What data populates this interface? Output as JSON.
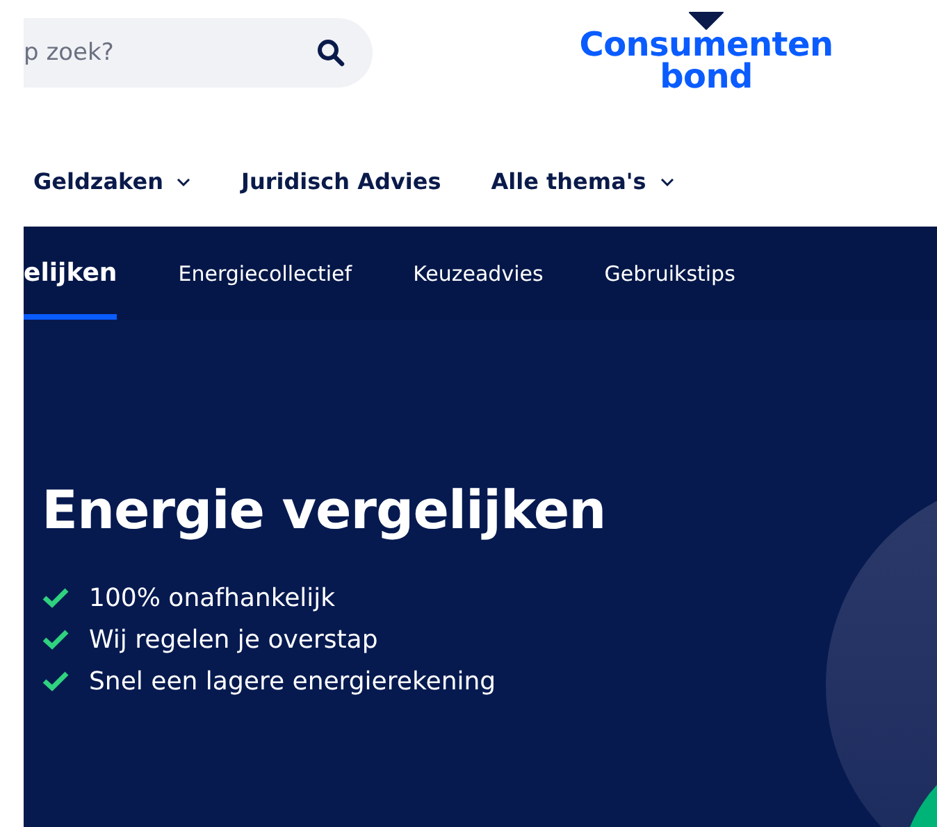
{
  "search": {
    "placeholder": "p zoek?"
  },
  "logo": {
    "line1": "Consumenten",
    "line2": "bond"
  },
  "nav": [
    {
      "label": "Geldzaken",
      "dropdown": true
    },
    {
      "label": "Juridisch Advies",
      "dropdown": false
    },
    {
      "label": "Alle thema's",
      "dropdown": true
    }
  ],
  "subtabs": [
    {
      "label": "elijken",
      "selected": true
    },
    {
      "label": "Energiecollectief",
      "selected": false
    },
    {
      "label": "Keuzeadvies",
      "selected": false
    },
    {
      "label": "Gebruikstips",
      "selected": false
    }
  ],
  "hero": {
    "title": "Energie vergelijken",
    "benefits": [
      "100% onafhankelijk",
      "Wij regelen je overstap",
      "Snel een lagere energierekening"
    ]
  }
}
